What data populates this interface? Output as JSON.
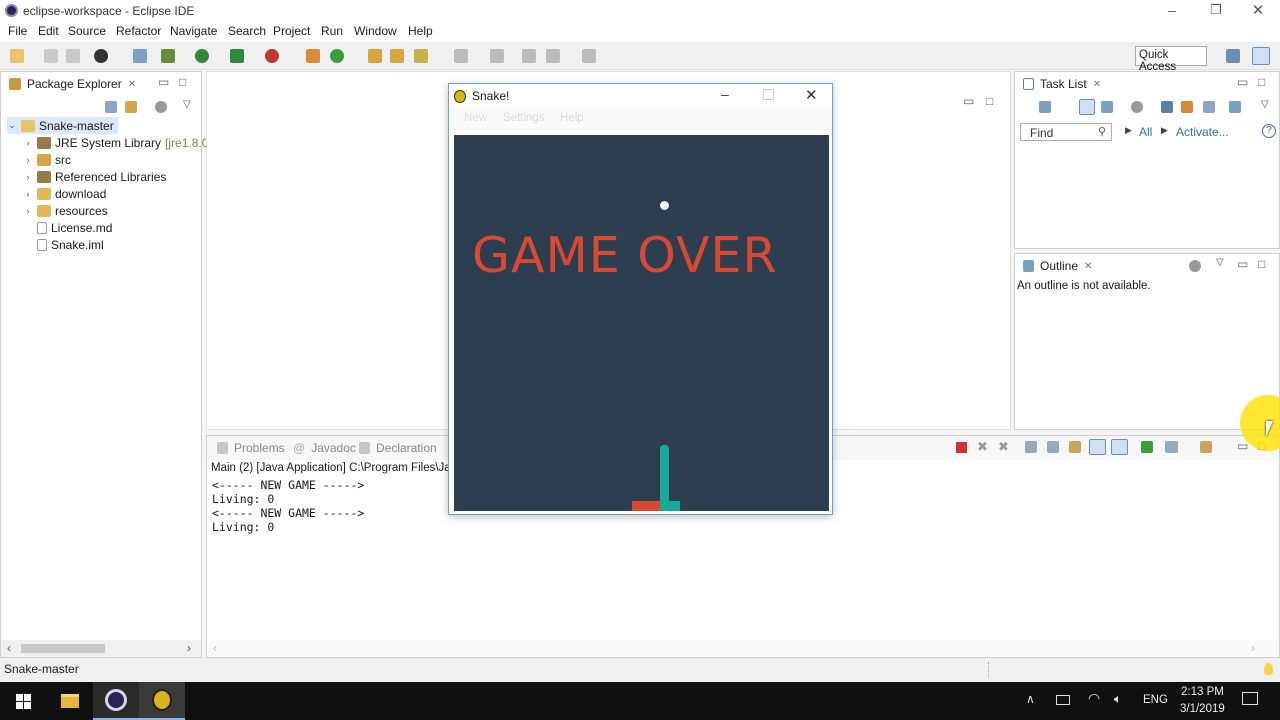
{
  "window": {
    "title": "eclipse-workspace - Eclipse IDE"
  },
  "menu": [
    "File",
    "Edit",
    "Source",
    "Refactor",
    "Navigate",
    "Search",
    "Project",
    "Run",
    "Window",
    "Help"
  ],
  "toolbar": {
    "quick_access": "Quick Access"
  },
  "package_explorer": {
    "tab_label": "Package Explorer",
    "project": "Snake-master",
    "items": [
      {
        "label": "JRE System Library",
        "suffix": "[jre1.8.0_1"
      },
      {
        "label": "src",
        "suffix": ""
      },
      {
        "label": "Referenced Libraries",
        "suffix": ""
      },
      {
        "label": "download",
        "suffix": ""
      },
      {
        "label": "resources",
        "suffix": ""
      },
      {
        "label": "License.md",
        "suffix": ""
      },
      {
        "label": "Snake.iml",
        "suffix": ""
      }
    ]
  },
  "task_list": {
    "tab_label": "Task List",
    "find_placeholder": "Find",
    "all": "All",
    "activate": "Activate..."
  },
  "outline": {
    "tab_label": "Outline",
    "message": "An outline is not available."
  },
  "console": {
    "tabs": [
      "Problems",
      "Javadoc",
      "Declaration"
    ],
    "header": "Main (2) [Java Application] C:\\Program Files\\Jav",
    "lines": [
      "<----- NEW GAME ----->",
      "Living: 0",
      "<----- NEW GAME ----->",
      "Living: 0"
    ]
  },
  "status_bar": {
    "text": "Snake-master"
  },
  "snake_window": {
    "title": "Snake!",
    "menu": [
      "New",
      "Settings",
      "Help"
    ],
    "game_over": "GAME OVER"
  },
  "taskbar": {
    "lang": "ENG",
    "time": "2:13 PM",
    "date": "3/1/2019"
  },
  "colors": {
    "game_bg": "#2c3e50",
    "game_over": "#d9492f",
    "snake": "#18a99a",
    "accent": "#2f6fb6"
  }
}
